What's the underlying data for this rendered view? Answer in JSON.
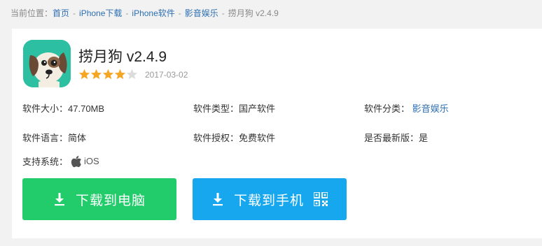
{
  "breadcrumb": {
    "prefix": "当前位置：",
    "items": [
      "首页",
      "iPhone下载",
      "iPhone软件",
      "影音娱乐"
    ],
    "current": "捞月狗 v2.4.9",
    "separator": "-"
  },
  "app": {
    "title": "捞月狗 v2.4.9",
    "rating": 4,
    "rating_max": 5,
    "date": "2017-03-02",
    "icon": "dog-app-icon"
  },
  "info": {
    "size_label": "软件大小：",
    "size_value": "47.70MB",
    "type_label": "软件类型：",
    "type_value": "国产软件",
    "category_label": "软件分类：",
    "category_value": "影音娱乐",
    "language_label": "软件语言：",
    "language_value": "简体",
    "license_label": "软件授权：",
    "license_value": "免费软件",
    "latest_label": "是否最新版：",
    "latest_value": "是",
    "os_label": "支持系统：",
    "os_value": "iOS"
  },
  "buttons": {
    "pc_label": "下载到电脑",
    "phone_label": "下载到手机"
  },
  "colors": {
    "link": "#2d6fb4",
    "star_on": "#f5a623",
    "star_off": "#dcdcdc",
    "btn_pc": "#22cc6b",
    "btn_phone": "#17a7ef"
  }
}
